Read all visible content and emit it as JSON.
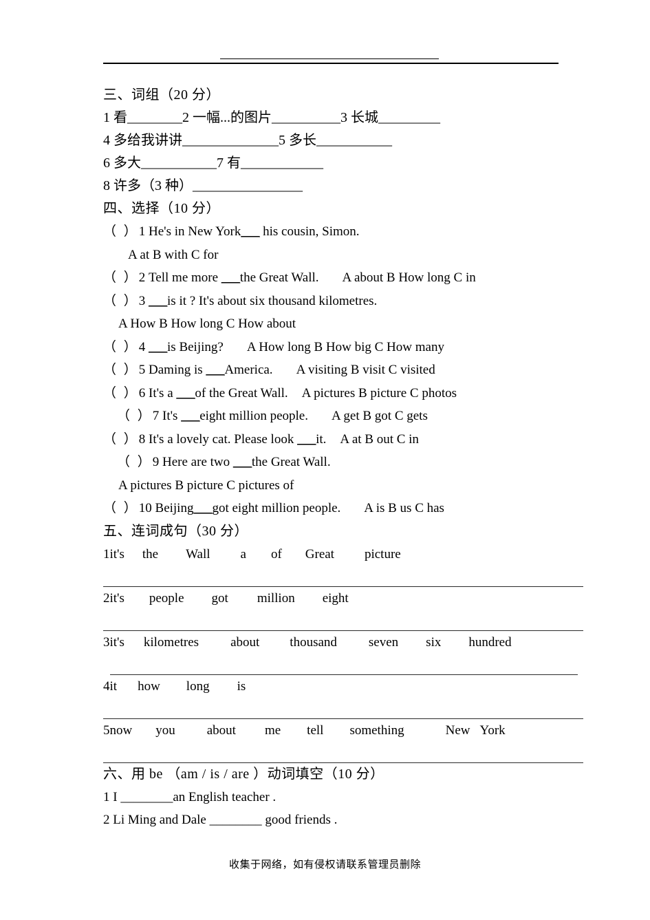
{
  "document": {
    "footer_note": "收集于网络，如有侵权请联系管理员删除"
  },
  "section_phrases": {
    "heading_cn": "三、词组（",
    "heading_score": "20",
    "heading_cn_tail": "分）",
    "heading_full": "三、词组（20 分）",
    "items_line1": "1 看________2 一幅...的图片__________3 长城_________",
    "items_line2": "4 多给我讲讲______________5 多长___________",
    "items_line3": "6 多大___________7 有____________",
    "items_line4": "8 许多（3 种）________________"
  },
  "section_choice": {
    "heading_full": "四、选择（10 分）",
    "questions": [
      {
        "marker": "（  ）",
        "number": "1",
        "stem_before": " He's in New York",
        "blank": "___",
        "stem_after": " his cousin, Simon.",
        "options_inline": "",
        "options_below": "A at      B with     C for"
      },
      {
        "marker": "（  ）",
        "number": "2",
        "stem_before": " Tell me more ",
        "blank": "___",
        "stem_after": "the Great Wall.",
        "options_inline": "A about     B How long   C in",
        "options_below": ""
      },
      {
        "marker": "（  ）",
        "number": "3",
        "stem_before": " ",
        "blank": "___",
        "stem_after": "is it ? It's about six thousand kilometres.",
        "options_inline": "",
        "options_below": "A How     B How long     C How about"
      },
      {
        "marker": "（  ）",
        "number": "4",
        "stem_before": " ",
        "blank": "___",
        "stem_after": "is Beijing?",
        "options_inline": "A How long    B How big    C How many",
        "options_below": ""
      },
      {
        "marker": "（  ）",
        "number": "5",
        "stem_before": " Daming is ",
        "blank": "___",
        "stem_after": "America.",
        "options_inline": "A visiting       B visit       C visited",
        "options_below": ""
      },
      {
        "marker": "（  ）",
        "number": "6",
        "stem_before": " It's a ",
        "blank": "___",
        "stem_after": "of the Great Wall.",
        "options_inline": "A pictures       B picture     C photos",
        "options_below": ""
      },
      {
        "marker": "（  ）",
        "number": "7",
        "stem_before": " It's ",
        "blank": "___",
        "stem_after": "eight million people.",
        "options_inline": "A get     B got      C gets",
        "options_below": ""
      },
      {
        "marker": "（  ）",
        "number": "8",
        "stem_before": " It's a lovely cat. Please look ",
        "blank": "___",
        "stem_after": "it.",
        "options_inline": "A at     B out      C in",
        "options_below": ""
      },
      {
        "marker": "（  ）",
        "number": "9",
        "stem_before": " Here are two ",
        "blank": "___",
        "stem_after": "the Great Wall.",
        "options_inline": "",
        "options_below": "A pictures      B picture      C pictures of"
      },
      {
        "marker": "（  ）",
        "number": "10",
        "stem_before": " Beijing",
        "blank": "___",
        "stem_after": "got eight million people.",
        "options_inline": "A is      B us        C has",
        "options_below": ""
      }
    ]
  },
  "section_scramble": {
    "heading_full": "五、连词成句（30 分）",
    "items": [
      {
        "number": "1",
        "words": [
          "it's",
          "the",
          "Wall",
          "a",
          "of",
          "Great",
          "picture"
        ]
      },
      {
        "number": "2",
        "words": [
          "it's",
          "people",
          "got",
          "million",
          "eight"
        ]
      },
      {
        "number": "3",
        "words": [
          "it's",
          "kilometres",
          "about",
          "thousand",
          "seven",
          "six",
          "hundred"
        ]
      },
      {
        "number": "4",
        "words": [
          "it",
          "how",
          "long",
          "is"
        ]
      },
      {
        "number": "5",
        "words": [
          "now",
          "you",
          "about",
          "me",
          "tell",
          "something",
          "New",
          "York"
        ]
      }
    ]
  },
  "section_be": {
    "heading_full": "六、用 be （am /  is  /  are ）动词填空（10 分）",
    "items": [
      "1 I ________an English teacher .",
      "2 Li Ming and Dale ________ good friends ."
    ]
  }
}
